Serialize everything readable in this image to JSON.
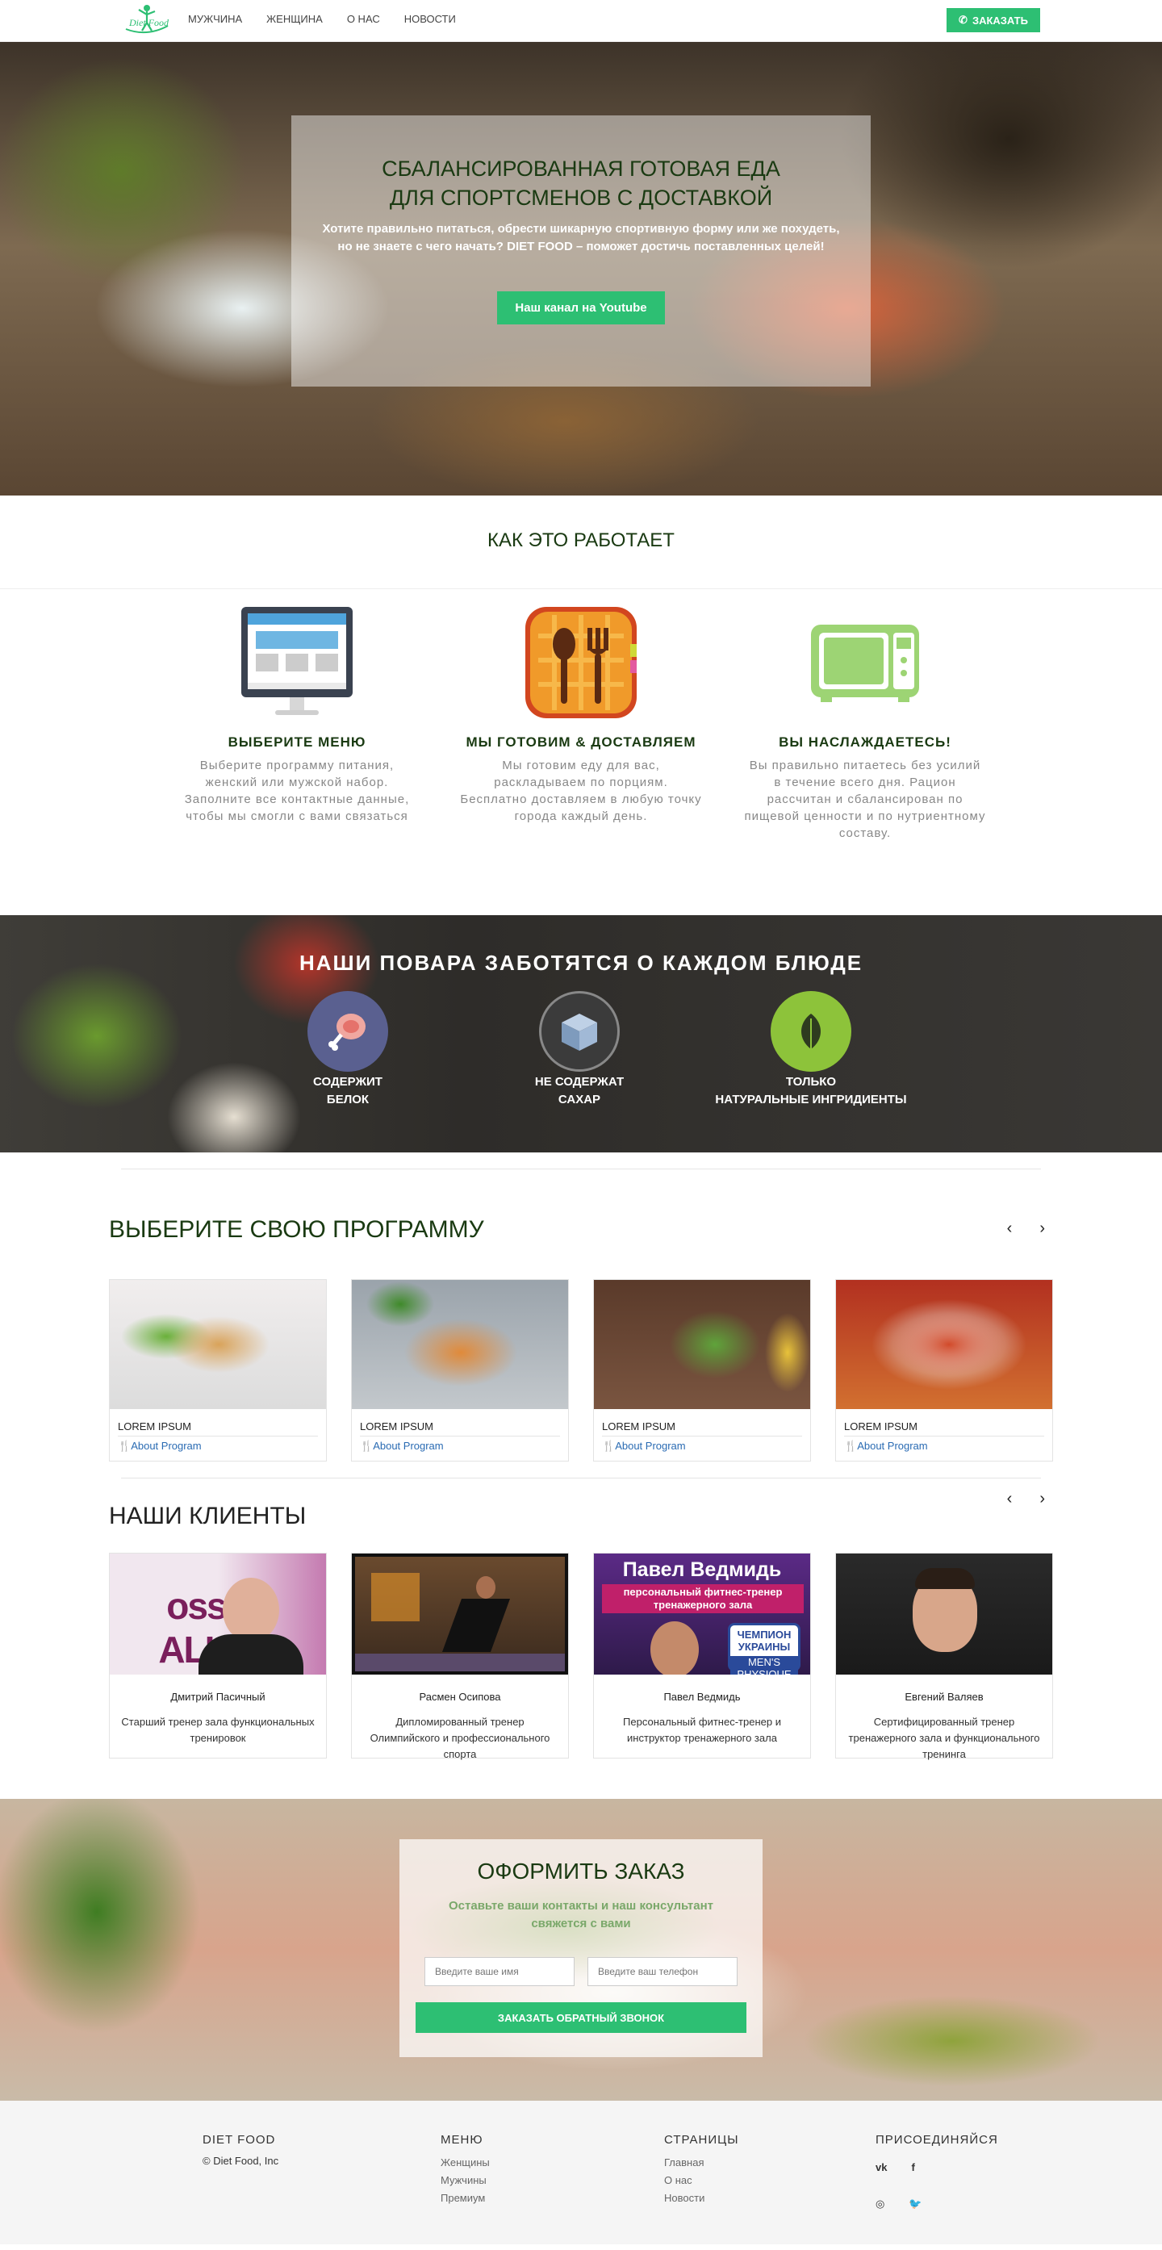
{
  "nav": {
    "logo_text": "Diet Food",
    "links": [
      "Мужчина",
      "Женщина",
      "О нас",
      "Новости"
    ],
    "order_label": "ЗАКАЗАТЬ"
  },
  "hero": {
    "title_line1": "СБАЛАНСИРОВАННАЯ ГОТОВАЯ ЕДА",
    "title_line2": "ДЛЯ СПОРТСМЕНОВ С ДОСТАВКОЙ",
    "subtitle": "Хотите правильно питаться, обрести шикарную спортивную форму или же похудеть, но не знаете с чего начать? DIET FOOD – поможет достичь поставленных целей!",
    "button": "Наш канал на Youtube"
  },
  "how": {
    "title": "КАК ЭТО РАБОТАЕТ",
    "steps": [
      {
        "title": "ВЫБЕРИТЕ МЕНЮ",
        "text": "Выберите программу питания, женский или мужской набор. Заполните все контактные данные, чтобы мы смогли с вами связаться"
      },
      {
        "title": "МЫ ГОТОВИМ & ДОСТАВЛЯЕМ",
        "text": "Мы готовим еду для вас, раскладываем по порциям. Бесплатно доставляем в любую точку города каждый день."
      },
      {
        "title": "ВЫ НАСЛАЖДАЕТЕСЬ!",
        "text": "Вы правильно питаетесь без усилий в течение всего дня. Рацион рассчитан и сбалансирован по пищевой ценности и по нутриентному составу."
      }
    ]
  },
  "chefs": {
    "title": "НАШИ ПОВАРА ЗАБОТЯТСЯ О КАЖДОМ БЛЮДЕ",
    "items": [
      {
        "line1": "СОДЕРЖИТ",
        "line2": "БЕЛОК",
        "icon": "meat-icon",
        "color": "#5a6090"
      },
      {
        "line1": "НЕ СОДЕРЖАТ",
        "line2": "САХАР",
        "icon": "sugar-cube-icon",
        "color": "#3b3b3b"
      },
      {
        "line1": "ТОЛЬКО",
        "line2": "НАТУРАЛЬНЫЕ ИНГРИДИЕНТЫ",
        "icon": "leaf-icon",
        "color": "#8dc33a"
      }
    ]
  },
  "programs": {
    "title": "ВЫБЕРИТЕ СВОЮ ПРОГРАММУ",
    "cards": [
      {
        "title": "LOREM IPSUM",
        "link": "About Program"
      },
      {
        "title": "LOREM IPSUM",
        "link": "About Program"
      },
      {
        "title": "LOREM IPSUM",
        "link": "About Program"
      },
      {
        "title": "LOREM IPSUM",
        "link": "About Program"
      }
    ]
  },
  "clients": {
    "title": "НАШИ КЛИЕНТЫ",
    "cards": [
      {
        "name": "Дмитрий Пасичный",
        "desc": "Старший тренер зала функциональных тренировок",
        "image_text": "ossFit ALLEN"
      },
      {
        "name": "Расмен Осипова",
        "desc": "Дипломированный тренер Олимпийского и профессионального спорта",
        "image_text": ""
      },
      {
        "name": "Павел Ведмидь",
        "desc": "Персональный фитнес-тренер и инструктор тренажерного зала",
        "image_text": "Павел Ведмидь",
        "image_sub": "персональный фитнес-тренер тренажерного зала",
        "badge": "ЧЕМПИОН УКРАИНЫ",
        "badge_sub": "MEN'S PHYSIQUE"
      },
      {
        "name": "Евгений Валяев",
        "desc": "Сертифицированный тренер тренажерного зала и функционального тренинга",
        "image_text": ""
      }
    ]
  },
  "order": {
    "title": "ОФОРМИТЬ ЗАКАЗ",
    "subtitle": "Оставьте ваши контакты и наш консультант свяжется с вами",
    "name_placeholder": "Введите ваше имя",
    "phone_placeholder": "Введите ваш телефон",
    "button": "ЗАКАЗАТЬ ОБРАТНЫЙ ЗВОНОК"
  },
  "footer": {
    "brand": "DIET FOOD",
    "copyright": "© Diet Food, Inc",
    "menu_title": "МЕНЮ",
    "menu_links": [
      "Женщины",
      "Мужчины",
      "Премиум"
    ],
    "pages_title": "СТРАНИЦЫ",
    "pages_links": [
      "Главная",
      "О нас",
      "Новости"
    ],
    "join_title": "ПРИСОЕДИНЯЙСЯ",
    "social": [
      "vk-icon",
      "facebook-icon",
      "instagram-icon",
      "twitter-icon"
    ]
  },
  "colors": {
    "accent": "#2dbf73",
    "heading": "#1a3a12",
    "link": "#2a6bb3"
  }
}
